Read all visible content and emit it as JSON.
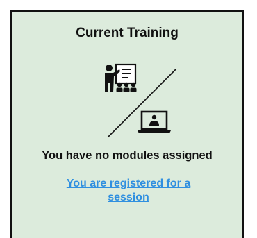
{
  "card": {
    "title": "Current Training",
    "illustration_icons": [
      "classroom-teacher-icon",
      "online-laptop-icon"
    ],
    "message": "You have no modules assigned",
    "link_text": "You are registered for a session"
  },
  "colors": {
    "card_background": "#dcebdc",
    "border": "#111111",
    "link": "#2f8fe0"
  }
}
